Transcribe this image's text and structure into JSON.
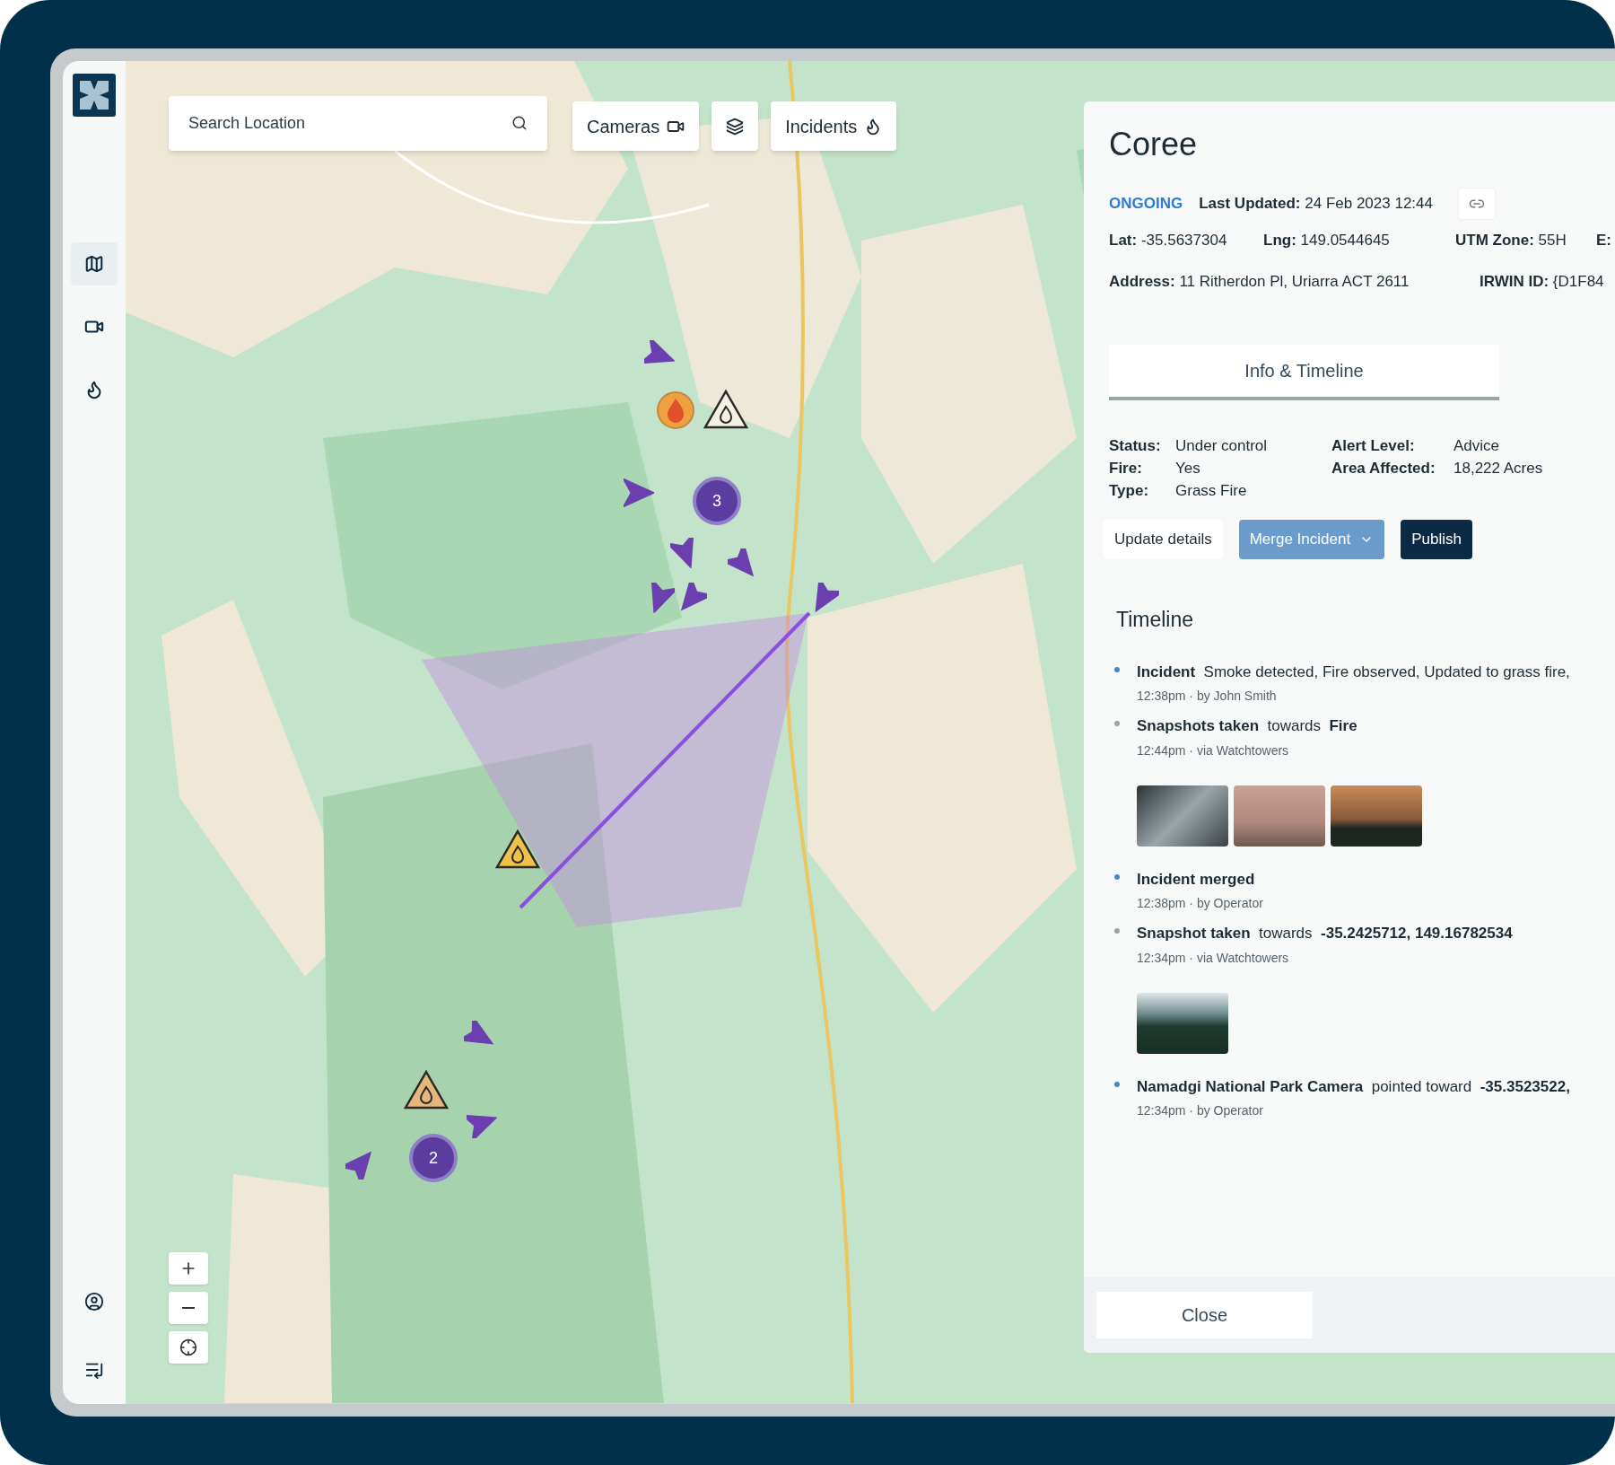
{
  "sidebar": {
    "items": [
      {
        "kind": "map",
        "selected": true
      },
      {
        "kind": "camera",
        "selected": false
      },
      {
        "kind": "fire",
        "selected": false
      }
    ],
    "bottom_items": [
      {
        "kind": "user"
      },
      {
        "kind": "collapse"
      }
    ]
  },
  "toolbar": {
    "search": {
      "placeholder": "Search Location"
    },
    "buttons": [
      {
        "kind": "camera",
        "label": "Cameras"
      },
      {
        "kind": "layers"
      },
      {
        "kind": "fire",
        "label": "Incidents"
      }
    ]
  },
  "map": {
    "clusters": [
      {
        "count": "3"
      },
      {
        "count": "2"
      }
    ],
    "zoom_controls": [
      {
        "kind": "zoom-in"
      },
      {
        "kind": "zoom-out"
      },
      {
        "kind": "locate"
      }
    ]
  },
  "incident": {
    "title": "Coree",
    "status": "ONGOING",
    "last_updated": {
      "label": "Last Updated:",
      "value": "24 Feb 2023 12:44"
    },
    "coordinates": [
      {
        "label": "Lat:",
        "value": "-35.5637304"
      },
      {
        "label": "Lng:",
        "value": "149.0544645"
      },
      {
        "label": "UTM Zone:",
        "value": "55H"
      },
      {
        "label": "E:"
      }
    ],
    "address": [
      {
        "label": "Address:",
        "value": "11 Ritherdon Pl, Uriarra ACT 2611"
      },
      {
        "label": "IRWIN ID:",
        "value": "{D1F84"
      }
    ],
    "tabs": [
      {
        "label": "Info & Timeline",
        "selected": true
      }
    ],
    "details_left": [
      {
        "label": "Status:",
        "value": "Under control"
      },
      {
        "label": "Fire:",
        "value": "Yes"
      },
      {
        "label": "Type:",
        "value": "Grass Fire"
      }
    ],
    "details_right": [
      {
        "label": "Alert Level:",
        "value": "Advice"
      },
      {
        "label": "Area Affected:",
        "value": "18,222 Acres"
      }
    ],
    "actions": [
      {
        "kind": "plain",
        "label": "Update details"
      },
      {
        "kind": "dropdown",
        "label": "Merge Incident"
      },
      {
        "kind": "primary",
        "label": "Publish"
      }
    ],
    "timeline": {
      "title": "Timeline",
      "items": [
        {
          "color": "#4a86c5",
          "text": "**Incident**  Smoke detected, Fire observed, Updated to grass fire,",
          "meta": "12:38pm · by John Smith"
        },
        {
          "color": "#9aa3a8",
          "text": "**Snapshots taken**  towards  **Fire**",
          "meta": "12:44pm · via Watchtowers",
          "snapshots": [
            {
              "kind": "smoke"
            },
            {
              "kind": "haze"
            },
            {
              "kind": "fire"
            }
          ]
        },
        {
          "color": "#4a86c5",
          "text": "**Incident merged**",
          "meta": "12:38pm · by Operator"
        },
        {
          "color": "#9aa3a8",
          "text": "**Snapshot taken**  towards  **-35.2425712, 149.16782534**",
          "meta": "12:34pm · via Watchtowers",
          "snapshots": [
            {
              "kind": "forest"
            }
          ]
        },
        {
          "color": "#4a86c5",
          "text": "**Namadgi National Park Camera**  pointed toward  **-35.3523522,**",
          "meta": "12:34pm · by Operator"
        }
      ]
    },
    "close": "Close"
  }
}
